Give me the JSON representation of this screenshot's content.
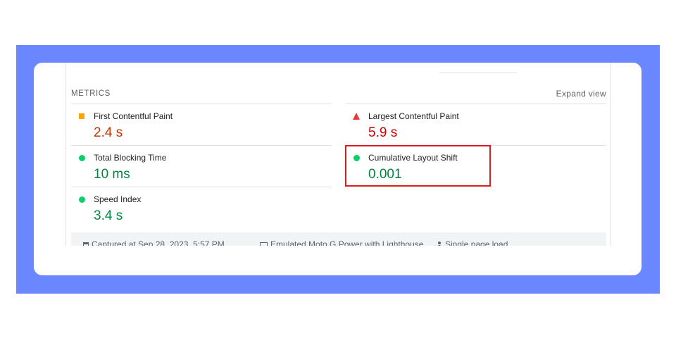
{
  "metrics": {
    "title": "METRICS",
    "expand_label": "Expand view",
    "items": [
      {
        "name": "First Contentful Paint",
        "value": "2.4 s",
        "status": "average",
        "color": "#c33300",
        "icon": "square-icon",
        "icon_color": "#ffa400"
      },
      {
        "name": "Largest Contentful Paint",
        "value": "5.9 s",
        "status": "poor",
        "color": "#cc0000",
        "icon": "triangle-icon",
        "icon_color": "#e53935"
      },
      {
        "name": "Total Blocking Time",
        "value": "10 ms",
        "status": "good",
        "color": "#018642",
        "icon": "circle-icon",
        "icon_color": "#0cce6b"
      },
      {
        "name": "Cumulative Layout Shift",
        "value": "0.001",
        "status": "good",
        "color": "#018642",
        "icon": "circle-icon",
        "icon_color": "#0cce6b"
      },
      {
        "name": "Speed Index",
        "value": "3.4 s",
        "status": "good",
        "color": "#018642",
        "icon": "circle-icon",
        "icon_color": "#0cce6b"
      }
    ]
  },
  "footer": {
    "captured": "Captured at Sep 28, 2023, 5:57 PM",
    "device": "Emulated Moto G Power with Lighthouse",
    "load": "Single page load"
  },
  "colors": {
    "frame": "#6b87ff",
    "highlight": "#d91c1c"
  }
}
